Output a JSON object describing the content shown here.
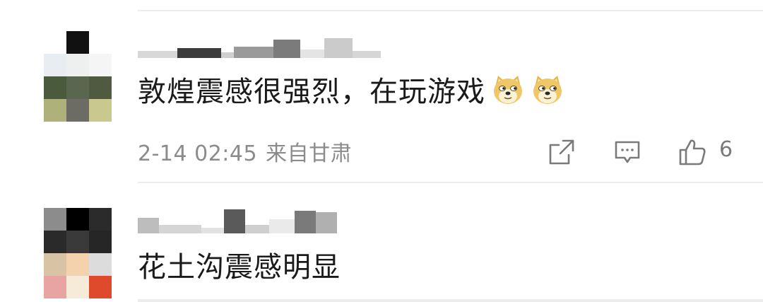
{
  "comments": [
    {
      "text": "敦煌震感很强烈，在玩游戏",
      "emoji_icon": "doge-emoji-icon",
      "emoji_count": 2,
      "date": "2-14 02:45",
      "location": "来自甘肃",
      "like_count": "6",
      "icons": {
        "share": "share-icon",
        "reply": "comment-icon",
        "like": "thumbs-up-icon"
      }
    },
    {
      "text": "花土沟震感明显"
    }
  ],
  "colors": {
    "text": "#1a1a1a",
    "meta": "#8b8b8b",
    "divider": "#ececec",
    "icon": "#7a7a7a"
  }
}
